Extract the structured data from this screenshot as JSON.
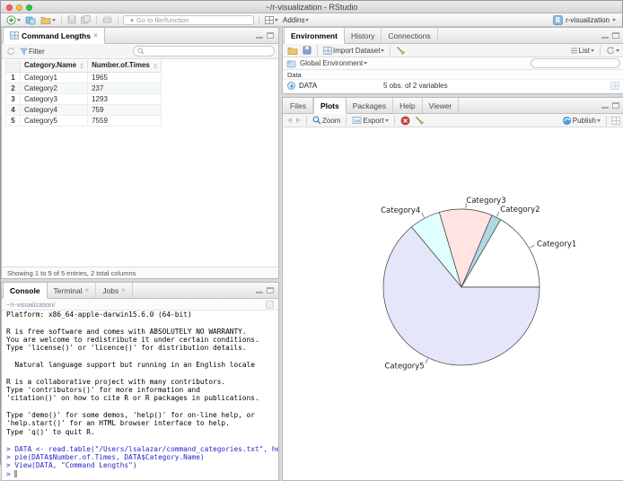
{
  "window": {
    "title": "~/r-visualization - RStudio"
  },
  "main_toolbar": {
    "goto_placeholder": "Go to file/function",
    "addins_label": "Addins",
    "project_name": "r-visualization"
  },
  "data_viewer": {
    "tab_title": "Command Lengths",
    "filter_label": "Filter",
    "columns": [
      "Category.Name",
      "Number.of.Times"
    ],
    "rows": [
      {
        "num": "1",
        "category": "Category1",
        "times": "1965"
      },
      {
        "num": "2",
        "category": "Category2",
        "times": "237"
      },
      {
        "num": "3",
        "category": "Category3",
        "times": "1293"
      },
      {
        "num": "4",
        "category": "Category4",
        "times": "759"
      },
      {
        "num": "5",
        "category": "Category5",
        "times": "7559"
      }
    ],
    "footer": "Showing 1 to 5 of 5 entries, 2 total columns"
  },
  "console_panel": {
    "tabs": [
      "Console",
      "Terminal",
      "Jobs"
    ],
    "path": "~/r-visualization/",
    "output_lines": [
      "Platform: x86_64-apple-darwin15.6.0 (64-bit)",
      "",
      "R is free software and comes with ABSOLUTELY NO WARRANTY.",
      "You are welcome to redistribute it under certain conditions.",
      "Type 'license()' or 'licence()' for distribution details.",
      "",
      "  Natural language support but running in an English locale",
      "",
      "R is a collaborative project with many contributors.",
      "Type 'contributors()' for more information and",
      "'citation()' on how to cite R or R packages in publications.",
      "",
      "Type 'demo()' for some demos, 'help()' for on-line help, or",
      "'help.start()' for an HTML browser interface to help.",
      "Type 'q()' to quit R.",
      ""
    ],
    "prompt": ">",
    "commands": [
      "DATA <- read.table(\"/Users/lsalazar/command_categories.txt\", header=TRUE)",
      "pie(DATA$Number.of.Times, DATA$Category.Name)",
      "View(DATA, \"Command Lengths\")"
    ]
  },
  "environment_panel": {
    "tabs": [
      "Environment",
      "History",
      "Connections"
    ],
    "import_dataset_label": "Import Dataset",
    "list_label": "List",
    "scope_label": "Global Environment",
    "section_label": "Data",
    "objects": [
      {
        "name": "DATA",
        "desc": "5 obs. of 2 variables"
      }
    ]
  },
  "plots_panel": {
    "tabs": [
      "Files",
      "Plots",
      "Packages",
      "Help",
      "Viewer"
    ],
    "active_tab": "Plots",
    "zoom_label": "Zoom",
    "export_label": "Export",
    "publish_label": "Publish"
  },
  "chart_data": {
    "type": "pie",
    "categories": [
      "Category1",
      "Category2",
      "Category3",
      "Category4",
      "Category5"
    ],
    "values": [
      1965,
      237,
      1293,
      759,
      7559
    ],
    "colors": [
      "#FFFFFF",
      "#ADD8E6",
      "#FFE4E1",
      "#E0FFFF",
      "#E6E6FA"
    ],
    "edge_color": "#3f3f3f",
    "label_color": "#1a1a1a",
    "start_angle_deg": 0,
    "direction": "counterclockwise",
    "title": "",
    "legend": "none"
  }
}
